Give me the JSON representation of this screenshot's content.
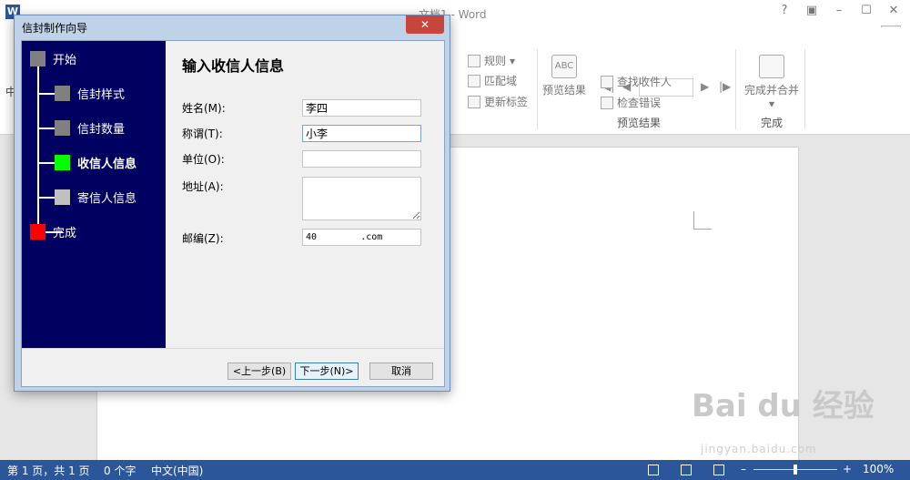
{
  "word": {
    "window_title": "文档1 - Word",
    "app_icon": "W",
    "controls": [
      "?",
      "▣",
      "–",
      "☐",
      "✕"
    ],
    "left_tab_stub": "中",
    "ribbon": {
      "rules": "规则",
      "match_fields": "匹配域",
      "update_labels": "更新标签",
      "preview_results_btn": "预览结果",
      "find_recipient": "查找收件人",
      "check_errors": "检查错误",
      "preview_group": "预览结果",
      "finish_merge_btn": "完成并合并",
      "finish_group": "完成",
      "nav_first": "◀|",
      "nav_prev": "◀",
      "nav_next": "▶",
      "nav_last": "|▶",
      "preview_icon_text": "ABC",
      "dropdown_caret": "▾"
    }
  },
  "dialog": {
    "title": "信封制作向导",
    "close_glyph": "✕",
    "steps": [
      {
        "label": "开始",
        "color": "#808080"
      },
      {
        "label": "信封样式",
        "color": "#808080"
      },
      {
        "label": "信封数量",
        "color": "#808080"
      },
      {
        "label": "收信人信息",
        "color": "#00ff00"
      },
      {
        "label": "寄信人信息",
        "color": "#c0c0c0"
      },
      {
        "label": "完成",
        "color": "#ff0000"
      }
    ],
    "heading": "输入收信人信息",
    "fields": {
      "name": {
        "label": "姓名(M):",
        "value": "李四"
      },
      "title": {
        "label": "称谓(T):",
        "value": "小李"
      },
      "company": {
        "label": "单位(O):",
        "value": ""
      },
      "address": {
        "label": "地址(A):",
        "value": ""
      },
      "postcode": {
        "label": "邮编(Z):",
        "value": "40        .com"
      }
    },
    "buttons": {
      "back": "<上一步(B)",
      "next": "下一步(N)>",
      "cancel": "取消"
    }
  },
  "status": {
    "page": "第 1 页，共 1 页",
    "words": "0 个字",
    "language": "中文(中国)",
    "zoom_minus": "–",
    "zoom_plus": "+",
    "zoom": "100%"
  },
  "watermark": {
    "main": "Bai du 经验",
    "sub": "jingyan.baidu.com"
  }
}
